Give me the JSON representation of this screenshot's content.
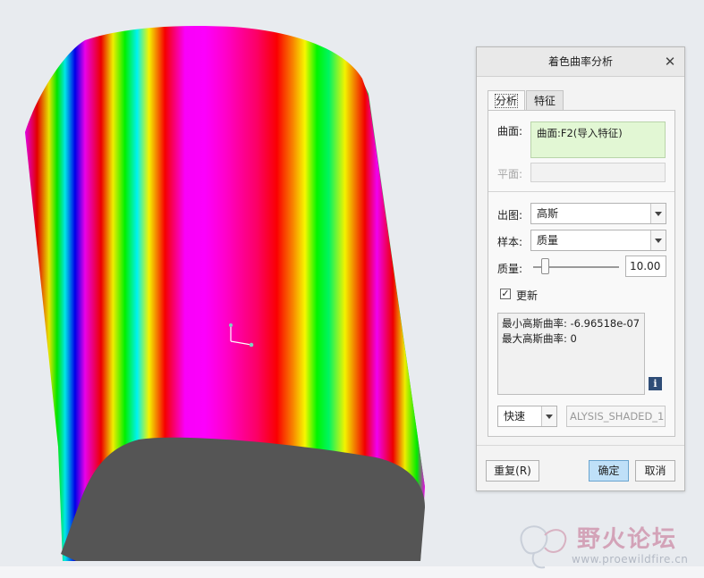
{
  "dialog": {
    "title": "着色曲率分析",
    "close_icon": "close-icon",
    "tabs": [
      {
        "label": "分析",
        "active": true
      },
      {
        "label": "特征",
        "active": false
      }
    ],
    "surface_label": "曲面:",
    "surface_value": "曲面:F2(导入特征)",
    "plane_label": "平面:",
    "plane_value": "",
    "output_label": "出图:",
    "output_value": "高斯",
    "sample_label": "样本:",
    "sample_value": "质量",
    "quality_label": "质量:",
    "quality_value": "10.00",
    "update_checked": true,
    "update_label": "更新",
    "results": [
      "最小高斯曲率: -6.96518e-07",
      "最大高斯曲率: 0"
    ],
    "info_icon": "info-icon",
    "mode_value": "快速",
    "analysis_name": "ALYSIS_SHADED_1",
    "repeat_button": "重复(R)",
    "ok_button": "确定",
    "cancel_button": "取消"
  },
  "watermark": {
    "name": "野火论坛",
    "url": "www.proewildfire.cn"
  },
  "colors": {
    "background": "#e8ebef",
    "surface_field_bg": "#e2f7d4",
    "primary_button": "#bfe0f8",
    "cap_face": "#555555",
    "rainbow": [
      "#ff00ff",
      "#ff0000",
      "#ffff00",
      "#00ff00",
      "#00ffff",
      "#0000ff"
    ]
  }
}
